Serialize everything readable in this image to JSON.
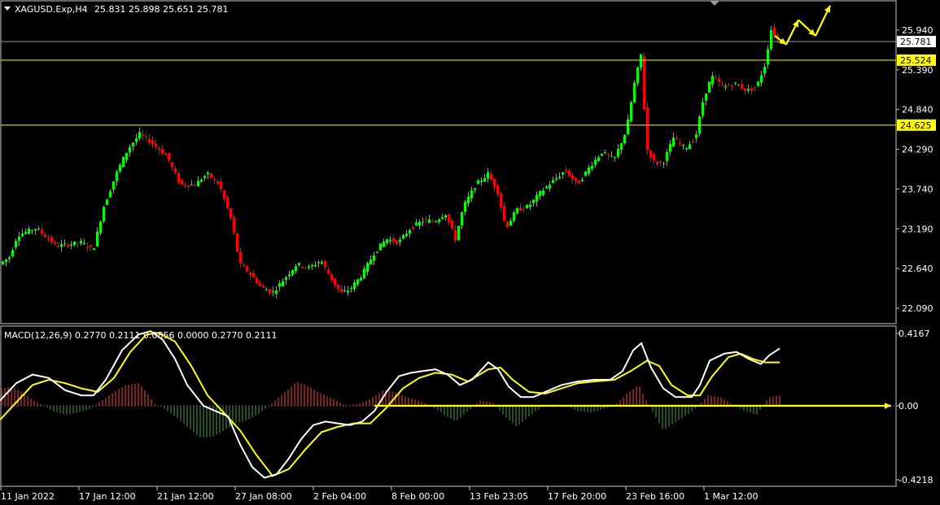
{
  "window": {
    "title": "XAGUSD.Exp,H4",
    "ohlc": "25.831 25.898 25.651 25.781",
    "macd_label": "MACD(12,26,9) 0.2770 0.2111 0.0856 0.0000 0.2770 0.2111"
  },
  "colors": {
    "background": "#000000",
    "bull": "#00ff00",
    "bear": "#ff0000",
    "level": "#ffff00",
    "current": "#9a9a9a",
    "macd_line": "#ffffff",
    "signal_line": "#ffff00",
    "hist_pos": "#a52a2a",
    "hist_neg": "#2e6b2e"
  },
  "price_axis": {
    "ticks": [
      "25.940",
      "25.390",
      "24.840",
      "24.290",
      "23.740",
      "23.190",
      "22.640",
      "22.090"
    ],
    "current": "25.781",
    "levels": [
      "25.524",
      "24.625"
    ]
  },
  "macd_axis": {
    "ticks": [
      "0.4167",
      "0.00",
      "-0.4218"
    ]
  },
  "time_axis": {
    "labels": [
      "11 Jan 2022",
      "17 Jan 12:00",
      "21 Jan 12:00",
      "27 Jan 08:00",
      "2 Feb 04:00",
      "8 Feb 00:00",
      "13 Feb 23:05",
      "17 Feb 20:00",
      "23 Feb 16:00",
      "1 Mar 12:00"
    ]
  },
  "chart_data": {
    "type": "line",
    "price_ylim": [
      21.9,
      26.2
    ],
    "macd_ylim": [
      -0.4218,
      0.4167
    ],
    "current_price": 25.781,
    "levels": [
      25.524,
      24.625
    ],
    "price_path": [
      [
        0,
        22.7
      ],
      [
        12,
        22.8
      ],
      [
        22,
        23.1
      ],
      [
        45,
        23.2
      ],
      [
        70,
        22.95
      ],
      [
        100,
        23.0
      ],
      [
        115,
        22.9
      ],
      [
        128,
        23.5
      ],
      [
        145,
        24.0
      ],
      [
        158,
        24.3
      ],
      [
        172,
        24.5
      ],
      [
        185,
        24.4
      ],
      [
        205,
        24.2
      ],
      [
        222,
        23.8
      ],
      [
        240,
        23.8
      ],
      [
        255,
        23.95
      ],
      [
        270,
        23.8
      ],
      [
        285,
        23.3
      ],
      [
        295,
        22.7
      ],
      [
        305,
        22.6
      ],
      [
        320,
        22.4
      ],
      [
        335,
        22.3
      ],
      [
        350,
        22.5
      ],
      [
        365,
        22.7
      ],
      [
        380,
        22.65
      ],
      [
        395,
        22.75
      ],
      [
        410,
        22.45
      ],
      [
        420,
        22.3
      ],
      [
        430,
        22.35
      ],
      [
        445,
        22.55
      ],
      [
        460,
        22.85
      ],
      [
        475,
        23.05
      ],
      [
        490,
        23.0
      ],
      [
        505,
        23.2
      ],
      [
        520,
        23.3
      ],
      [
        535,
        23.3
      ],
      [
        548,
        23.4
      ],
      [
        560,
        23.05
      ],
      [
        570,
        23.5
      ],
      [
        585,
        23.8
      ],
      [
        600,
        23.95
      ],
      [
        612,
        23.7
      ],
      [
        622,
        23.2
      ],
      [
        635,
        23.45
      ],
      [
        650,
        23.5
      ],
      [
        665,
        23.7
      ],
      [
        680,
        23.85
      ],
      [
        695,
        24.0
      ],
      [
        710,
        23.8
      ],
      [
        725,
        24.05
      ],
      [
        740,
        24.25
      ],
      [
        755,
        24.15
      ],
      [
        770,
        24.55
      ],
      [
        780,
        25.2
      ],
      [
        788,
        25.6
      ],
      [
        795,
        24.3
      ],
      [
        805,
        24.1
      ],
      [
        815,
        24.1
      ],
      [
        828,
        24.45
      ],
      [
        842,
        24.3
      ],
      [
        855,
        24.45
      ],
      [
        865,
        25.0
      ],
      [
        875,
        25.3
      ],
      [
        890,
        25.15
      ],
      [
        905,
        25.2
      ],
      [
        918,
        25.1
      ],
      [
        930,
        25.15
      ],
      [
        940,
        25.45
      ],
      [
        948,
        25.95
      ],
      [
        958,
        25.78
      ]
    ],
    "macd_main": [
      [
        0,
        0.03
      ],
      [
        20,
        0.13
      ],
      [
        40,
        0.18
      ],
      [
        60,
        0.16
      ],
      [
        80,
        0.09
      ],
      [
        100,
        0.06
      ],
      [
        115,
        0.06
      ],
      [
        130,
        0.15
      ],
      [
        150,
        0.32
      ],
      [
        170,
        0.41
      ],
      [
        185,
        0.43
      ],
      [
        200,
        0.38
      ],
      [
        215,
        0.27
      ],
      [
        230,
        0.12
      ],
      [
        250,
        0.0
      ],
      [
        265,
        -0.03
      ],
      [
        280,
        -0.06
      ],
      [
        295,
        -0.22
      ],
      [
        310,
        -0.35
      ],
      [
        325,
        -0.41
      ],
      [
        340,
        -0.39
      ],
      [
        355,
        -0.3
      ],
      [
        370,
        -0.19
      ],
      [
        385,
        -0.11
      ],
      [
        400,
        -0.09
      ],
      [
        415,
        -0.1
      ],
      [
        430,
        -0.11
      ],
      [
        445,
        -0.09
      ],
      [
        460,
        -0.03
      ],
      [
        475,
        0.08
      ],
      [
        490,
        0.17
      ],
      [
        505,
        0.19
      ],
      [
        520,
        0.2
      ],
      [
        535,
        0.21
      ],
      [
        550,
        0.18
      ],
      [
        565,
        0.12
      ],
      [
        580,
        0.15
      ],
      [
        600,
        0.25
      ],
      [
        612,
        0.21
      ],
      [
        625,
        0.11
      ],
      [
        640,
        0.05
      ],
      [
        655,
        0.05
      ],
      [
        670,
        0.08
      ],
      [
        690,
        0.12
      ],
      [
        710,
        0.14
      ],
      [
        730,
        0.15
      ],
      [
        750,
        0.15
      ],
      [
        765,
        0.2
      ],
      [
        778,
        0.32
      ],
      [
        788,
        0.36
      ],
      [
        800,
        0.22
      ],
      [
        815,
        0.1
      ],
      [
        830,
        0.05
      ],
      [
        850,
        0.05
      ],
      [
        860,
        0.12
      ],
      [
        872,
        0.26
      ],
      [
        890,
        0.3
      ],
      [
        905,
        0.31
      ],
      [
        920,
        0.27
      ],
      [
        935,
        0.24
      ],
      [
        945,
        0.29
      ],
      [
        958,
        0.33
      ]
    ],
    "macd_signal": [
      [
        0,
        -0.08
      ],
      [
        20,
        0.02
      ],
      [
        40,
        0.12
      ],
      [
        60,
        0.15
      ],
      [
        80,
        0.13
      ],
      [
        100,
        0.1
      ],
      [
        120,
        0.08
      ],
      [
        140,
        0.16
      ],
      [
        160,
        0.31
      ],
      [
        180,
        0.41
      ],
      [
        195,
        0.42
      ],
      [
        215,
        0.37
      ],
      [
        235,
        0.23
      ],
      [
        255,
        0.06
      ],
      [
        275,
        -0.04
      ],
      [
        295,
        -0.14
      ],
      [
        315,
        -0.28
      ],
      [
        335,
        -0.4
      ],
      [
        355,
        -0.36
      ],
      [
        375,
        -0.25
      ],
      [
        395,
        -0.15
      ],
      [
        415,
        -0.12
      ],
      [
        435,
        -0.1
      ],
      [
        455,
        -0.1
      ],
      [
        475,
        -0.01
      ],
      [
        495,
        0.1
      ],
      [
        515,
        0.16
      ],
      [
        535,
        0.19
      ],
      [
        555,
        0.18
      ],
      [
        575,
        0.14
      ],
      [
        600,
        0.21
      ],
      [
        615,
        0.22
      ],
      [
        630,
        0.15
      ],
      [
        650,
        0.08
      ],
      [
        670,
        0.07
      ],
      [
        690,
        0.1
      ],
      [
        710,
        0.13
      ],
      [
        730,
        0.14
      ],
      [
        755,
        0.15
      ],
      [
        775,
        0.2
      ],
      [
        795,
        0.26
      ],
      [
        810,
        0.23
      ],
      [
        825,
        0.12
      ],
      [
        845,
        0.06
      ],
      [
        860,
        0.06
      ],
      [
        875,
        0.17
      ],
      [
        895,
        0.28
      ],
      [
        910,
        0.3
      ],
      [
        925,
        0.27
      ],
      [
        940,
        0.25
      ],
      [
        958,
        0.25
      ]
    ],
    "macd_hist": [
      [
        0,
        0.1
      ],
      [
        15,
        0.11
      ],
      [
        30,
        0.07
      ],
      [
        45,
        0.02
      ],
      [
        55,
        0.0
      ],
      [
        65,
        -0.03
      ],
      [
        80,
        -0.05
      ],
      [
        95,
        -0.04
      ],
      [
        110,
        -0.02
      ],
      [
        125,
        0.03
      ],
      [
        140,
        0.08
      ],
      [
        155,
        0.12
      ],
      [
        170,
        0.13
      ],
      [
        180,
        0.08
      ],
      [
        190,
        0.01
      ],
      [
        200,
        -0.01
      ],
      [
        215,
        -0.06
      ],
      [
        230,
        -0.12
      ],
      [
        245,
        -0.18
      ],
      [
        260,
        -0.18
      ],
      [
        275,
        -0.14
      ],
      [
        290,
        -0.1
      ],
      [
        305,
        -0.08
      ],
      [
        320,
        -0.04
      ],
      [
        335,
        0.02
      ],
      [
        350,
        0.08
      ],
      [
        365,
        0.14
      ],
      [
        380,
        0.11
      ],
      [
        395,
        0.07
      ],
      [
        410,
        0.04
      ],
      [
        425,
        0.0
      ],
      [
        440,
        0.01
      ],
      [
        455,
        0.04
      ],
      [
        470,
        0.09
      ],
      [
        485,
        0.08
      ],
      [
        500,
        0.05
      ],
      [
        515,
        0.03
      ],
      [
        530,
        0.0
      ],
      [
        545,
        -0.05
      ],
      [
        560,
        -0.09
      ],
      [
        575,
        -0.03
      ],
      [
        590,
        0.03
      ],
      [
        605,
        0.02
      ],
      [
        620,
        -0.06
      ],
      [
        635,
        -0.12
      ],
      [
        650,
        -0.06
      ],
      [
        665,
        -0.01
      ],
      [
        680,
        0.01
      ],
      [
        695,
        0.0
      ],
      [
        710,
        -0.03
      ],
      [
        725,
        -0.04
      ],
      [
        740,
        -0.02
      ],
      [
        755,
        0.0
      ],
      [
        770,
        0.07
      ],
      [
        785,
        0.12
      ],
      [
        795,
        0.02
      ],
      [
        805,
        -0.06
      ],
      [
        815,
        -0.14
      ],
      [
        828,
        -0.1
      ],
      [
        845,
        -0.05
      ],
      [
        858,
        0.0
      ],
      [
        870,
        0.06
      ],
      [
        885,
        0.05
      ],
      [
        900,
        0.01
      ],
      [
        915,
        -0.03
      ],
      [
        930,
        -0.05
      ],
      [
        945,
        0.05
      ],
      [
        958,
        0.06
      ]
    ],
    "time_label_x": [
      0,
      96,
      192,
      288,
      384,
      480,
      576,
      672,
      768,
      864
    ],
    "arrows": [
      [
        [
          952,
          25.86
        ],
        [
          966,
          25.74
        ]
      ],
      [
        [
          966,
          25.74
        ],
        [
          981,
          26.08
        ]
      ],
      [
        [
          981,
          26.08
        ],
        [
          1002,
          25.86
        ]
      ],
      [
        [
          1002,
          25.86
        ],
        [
          1020,
          26.28
        ]
      ]
    ],
    "macd_arrow": [
      [
        460,
        0.0
      ],
      [
        1095,
        0.0
      ]
    ]
  }
}
